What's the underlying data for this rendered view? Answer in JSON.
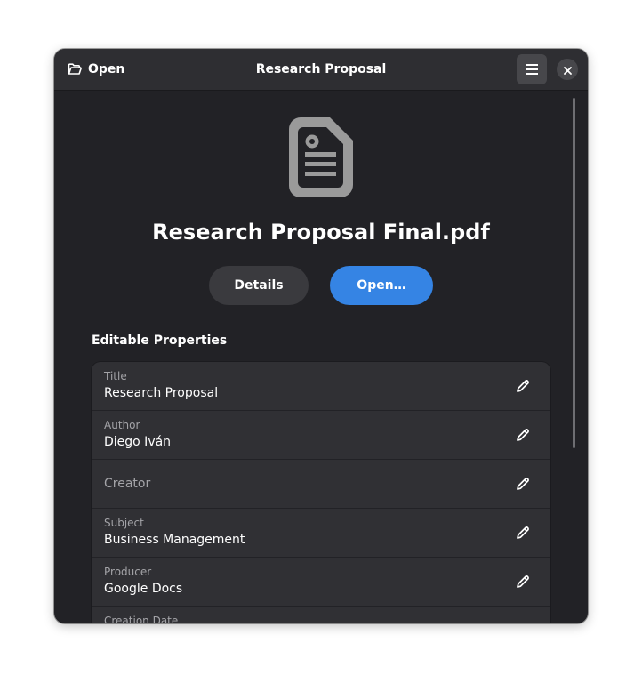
{
  "header": {
    "open_label": "Open",
    "title": "Research Proposal"
  },
  "icons": {
    "open": "folder-open-icon",
    "menu": "hamburger-menu-icon",
    "close": "close-icon",
    "document": "document-icon",
    "edit": "pencil-icon"
  },
  "file": {
    "name": "Research Proposal Final.pdf"
  },
  "actions": {
    "details_label": "Details",
    "open_label": "Open…"
  },
  "properties": {
    "section_title": "Editable Properties",
    "rows": [
      {
        "label": "Title",
        "value": "Research Proposal"
      },
      {
        "label": "Author",
        "value": "Diego Iván"
      },
      {
        "placeholder": "Creator"
      },
      {
        "label": "Subject",
        "value": "Business Management"
      },
      {
        "label": "Producer",
        "value": "Google Docs"
      },
      {
        "label": "Creation Date",
        "value": ""
      }
    ]
  },
  "colors": {
    "window_bg": "#222226",
    "accent": "#3584e4",
    "row_bg": "#303034"
  }
}
